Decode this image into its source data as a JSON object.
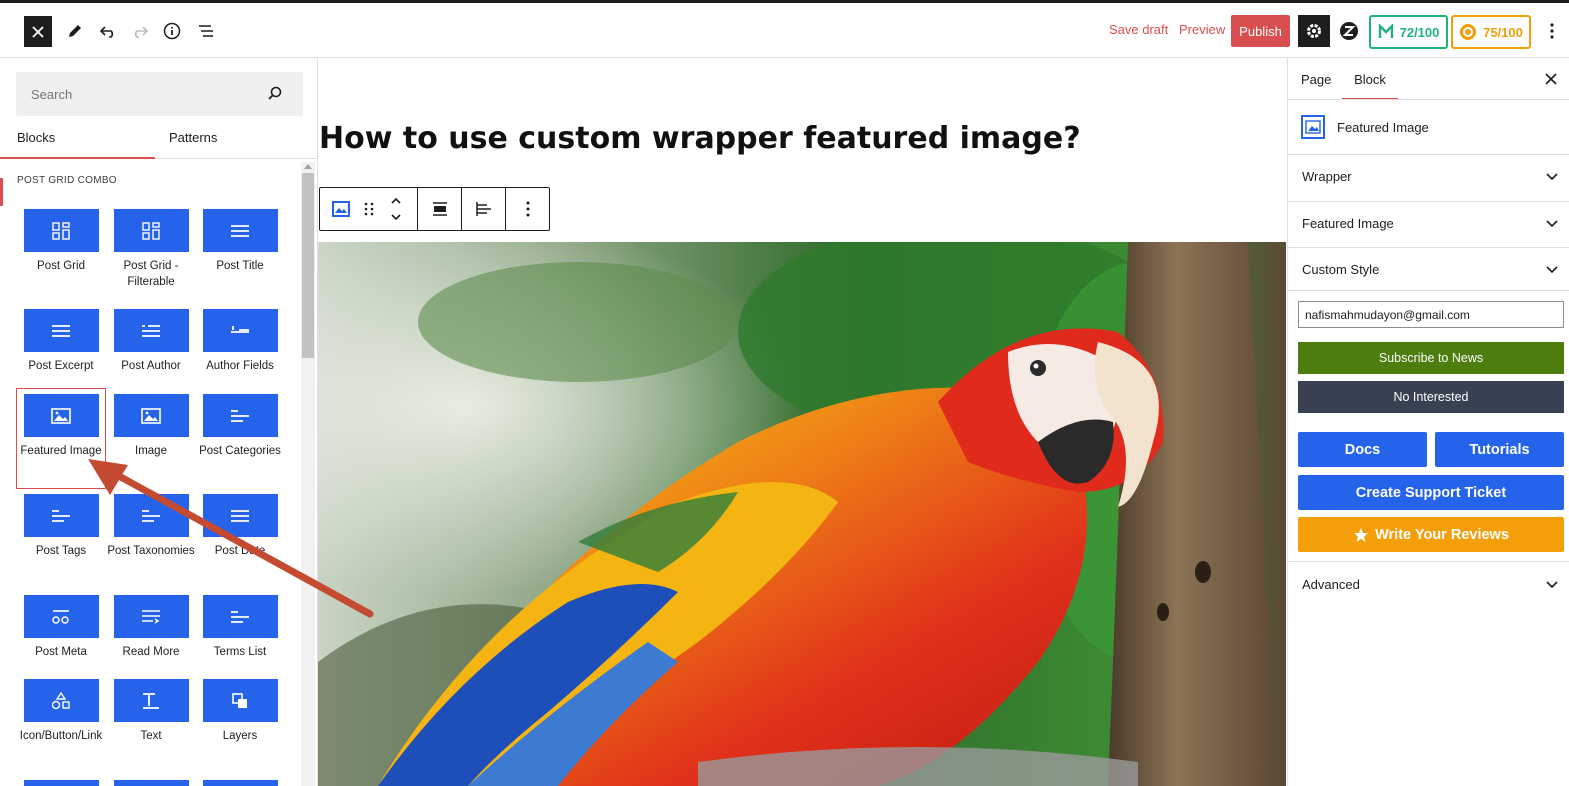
{
  "topbar": {
    "close_icon": "close-icon",
    "tool_icons": [
      "pencil-icon",
      "undo-icon",
      "redo-icon",
      "info-icon",
      "list-view-icon"
    ],
    "save_draft": "Save draft",
    "preview": "Preview",
    "publish": "Publish",
    "settings_icon": "gear-icon",
    "plugin_icon": "plugin-z-icon",
    "score_green": "72/100",
    "score_orange": "75/100",
    "more_icon": "vertical-dots-icon",
    "colors": {
      "accent": "#d94f4f",
      "green": "#20b27c",
      "orange": "#f49f0a"
    }
  },
  "inserter": {
    "search_placeholder": "Search",
    "tabs": [
      "Blocks",
      "Patterns"
    ],
    "section_title": "POST GRID COMBO",
    "blocks": [
      {
        "label": "Post Grid",
        "icon": "grid-icon"
      },
      {
        "label": "Post Grid - Filterable",
        "icon": "grid-icon"
      },
      {
        "label": "Post Title",
        "icon": "lines-icon"
      },
      {
        "label": "Post Excerpt",
        "icon": "lines-icon"
      },
      {
        "label": "Post Author",
        "icon": "author-icon"
      },
      {
        "label": "Author Fields",
        "icon": "author-fields-icon"
      },
      {
        "label": "Featured Image",
        "icon": "image-icon"
      },
      {
        "label": "Image",
        "icon": "image-icon"
      },
      {
        "label": "Post Categories",
        "icon": "category-icon"
      },
      {
        "label": "Post Tags",
        "icon": "category-icon"
      },
      {
        "label": "Post Taxonomies",
        "icon": "category-icon"
      },
      {
        "label": "Post Date",
        "icon": "lines-icon"
      },
      {
        "label": "Post Meta",
        "icon": "meta-icon"
      },
      {
        "label": "Read More",
        "icon": "read-more-icon"
      },
      {
        "label": "Terms List",
        "icon": "category-icon"
      },
      {
        "label": "Icon/Button/Link",
        "icon": "shapes-icon"
      },
      {
        "label": "Text",
        "icon": "text-icon"
      },
      {
        "label": "Layers",
        "icon": "layers-icon"
      }
    ]
  },
  "canvas": {
    "post_title": "How to use custom wrapper featured image?",
    "toolbar_icons": [
      "image-icon",
      "drag-icon",
      "move-icon",
      "align-icon",
      "justify-icon",
      "options-icon"
    ],
    "image_alt": "scarlet-macaw-photo"
  },
  "sidebar": {
    "tabs": [
      "Page",
      "Block"
    ],
    "block_name": "Featured Image",
    "panels": [
      "Wrapper",
      "Featured Image",
      "Custom Style",
      "Advanced"
    ],
    "email_value": "nafismahmudayon@gmail.com",
    "subscribe": "Subscribe to News",
    "not_interested": "No Interested",
    "docs": "Docs",
    "tutorials": "Tutorials",
    "support": "Create Support Ticket",
    "reviews": "Write Your Reviews"
  }
}
